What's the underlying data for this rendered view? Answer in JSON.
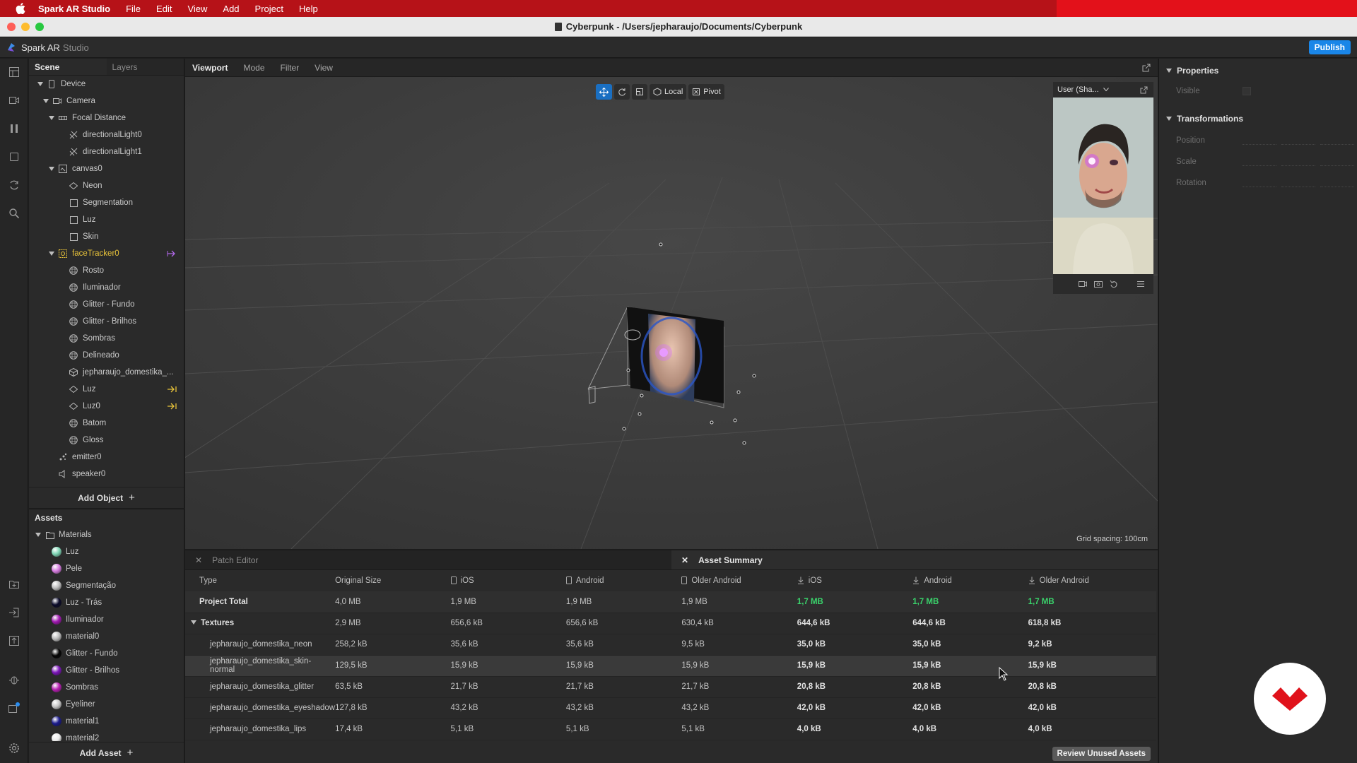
{
  "menubar": {
    "app_name": "Spark AR Studio",
    "items": [
      "File",
      "Edit",
      "View",
      "Add",
      "Project",
      "Help"
    ]
  },
  "window": {
    "title": "Cyberpunk - /Users/jepharaujo/Documents/Cyberpunk"
  },
  "app_header": {
    "brand": "Spark AR",
    "brand_suffix": "Studio",
    "publish_label": "Publish",
    "publish_color": "#1a86e8"
  },
  "left_toolbar": {
    "icons": [
      "layout-icon",
      "video-icon",
      "pause-icon",
      "square-icon",
      "sync-icon",
      "search-icon",
      "folder-add-icon",
      "import-icon",
      "export-icon",
      "bug-icon",
      "notification-icon",
      "settings-icon"
    ]
  },
  "scene_panel": {
    "tabs": [
      "Scene",
      "Layers"
    ],
    "tree": [
      {
        "label": "Device",
        "level": 0,
        "icon": "device"
      },
      {
        "label": "Camera",
        "level": 1,
        "icon": "camera"
      },
      {
        "label": "Focal Distance",
        "level": 2,
        "icon": "focal"
      },
      {
        "label": "directionalLight0",
        "level": 3,
        "icon": "light"
      },
      {
        "label": "directionalLight1",
        "level": 3,
        "icon": "light"
      },
      {
        "label": "canvas0",
        "level": 2,
        "icon": "canvas"
      },
      {
        "label": "Neon",
        "level": 3,
        "icon": "plane"
      },
      {
        "label": "Segmentation",
        "level": 3,
        "icon": "rect"
      },
      {
        "label": "Luz",
        "level": 3,
        "icon": "rect"
      },
      {
        "label": "Skin",
        "level": 3,
        "icon": "rect"
      },
      {
        "label": "faceTracker0",
        "level": 2,
        "icon": "facetracker"
      },
      {
        "label": "Rosto",
        "level": 3,
        "icon": "mesh"
      },
      {
        "label": "Iluminador",
        "level": 3,
        "icon": "mesh"
      },
      {
        "label": "Glitter - Fundo",
        "level": 3,
        "icon": "mesh"
      },
      {
        "label": "Glitter - Brilhos",
        "level": 3,
        "icon": "mesh"
      },
      {
        "label": "Sombras",
        "level": 3,
        "icon": "mesh"
      },
      {
        "label": "Delineado",
        "level": 3,
        "icon": "mesh"
      },
      {
        "label": "jepharaujo_domestika_...",
        "level": 3,
        "icon": "3d"
      },
      {
        "label": "Luz",
        "level": 3,
        "icon": "plane"
      },
      {
        "label": "Luz0",
        "level": 3,
        "icon": "plane"
      },
      {
        "label": "Batom",
        "level": 3,
        "icon": "mesh"
      },
      {
        "label": "Gloss",
        "level": 3,
        "icon": "mesh"
      },
      {
        "label": "emitter0",
        "level": 2,
        "icon": "emitter"
      },
      {
        "label": "speaker0",
        "level": 2,
        "icon": "speaker"
      }
    ],
    "add_object_label": "Add Object"
  },
  "assets_panel": {
    "title": "Assets",
    "folder": "Materials",
    "materials": [
      {
        "label": "Luz",
        "color": "#7fd6b5"
      },
      {
        "label": "Pele",
        "color": "#d77de0"
      },
      {
        "label": "Segmentação",
        "color": "#bfbfbf"
      },
      {
        "label": "Luz - Trás",
        "color": "#0b0b2a"
      },
      {
        "label": "Iluminador",
        "color": "#a018b0"
      },
      {
        "label": "material0",
        "color": "#bdbdbd"
      },
      {
        "label": "Glitter - Fundo",
        "color": "#050505"
      },
      {
        "label": "Glitter - Brilhos",
        "color": "#7a14b8"
      },
      {
        "label": "Sombras",
        "color": "#b71fb2"
      },
      {
        "label": "Eyeliner",
        "color": "#c8c8c8"
      },
      {
        "label": "material1",
        "color": "#1b1b8c"
      },
      {
        "label": "material2",
        "color": "#ececec"
      }
    ],
    "add_asset_label": "Add Asset"
  },
  "viewport": {
    "tabs": [
      "Viewport",
      "Mode",
      "Filter",
      "View"
    ],
    "toolbar": {
      "local_label": "Local",
      "pivot_label": "Pivot"
    },
    "simulator_label": "User (Sha...",
    "grid_spacing": "Grid spacing: 100cm"
  },
  "properties": {
    "section_properties": "Properties",
    "visible_label": "Visible",
    "section_transformations": "Transformations",
    "rows": [
      "Position",
      "Scale",
      "Rotation"
    ]
  },
  "bottom_panel": {
    "tabs": [
      "Patch Editor",
      "Asset Summary"
    ],
    "columns": [
      "Type",
      "Original Size",
      "iOS",
      "Android",
      "Older Android",
      "iOS",
      "Android",
      "Older Android"
    ],
    "project_total": {
      "label": "Project Total",
      "values": [
        "4,0 MB",
        "1,9 MB",
        "1,9 MB",
        "1,9 MB",
        "1,7 MB",
        "1,7 MB",
        "1,7 MB"
      ]
    },
    "textures": {
      "label": "Textures",
      "values": [
        "2,9 MB",
        "656,6 kB",
        "656,6 kB",
        "630,4 kB",
        "644,6 kB",
        "644,6 kB",
        "618,8 kB"
      ]
    },
    "rows": [
      {
        "name": "jepharaujo_domestika_neon",
        "values": [
          "258,2 kB",
          "35,6 kB",
          "35,6 kB",
          "9,5 kB",
          "35,0 kB",
          "35,0 kB",
          "9,2 kB"
        ]
      },
      {
        "name": "jepharaujo_domestika_skin-normal",
        "values": [
          "129,5 kB",
          "15,9 kB",
          "15,9 kB",
          "15,9 kB",
          "15,9 kB",
          "15,9 kB",
          "15,9 kB"
        ]
      },
      {
        "name": "jepharaujo_domestika_glitter",
        "values": [
          "63,5 kB",
          "21,7 kB",
          "21,7 kB",
          "21,7 kB",
          "20,8 kB",
          "20,8 kB",
          "20,8 kB"
        ]
      },
      {
        "name": "jepharaujo_domestika_eyeshadow",
        "values": [
          "127,8 kB",
          "43,2 kB",
          "43,2 kB",
          "43,2 kB",
          "42,0 kB",
          "42,0 kB",
          "42,0 kB"
        ]
      },
      {
        "name": "jepharaujo_domestika_lips",
        "values": [
          "17,4 kB",
          "5,1 kB",
          "5,1 kB",
          "5,1 kB",
          "4,0 kB",
          "4,0 kB",
          "4,0 kB"
        ]
      }
    ],
    "review_label": "Review Unused Assets"
  }
}
